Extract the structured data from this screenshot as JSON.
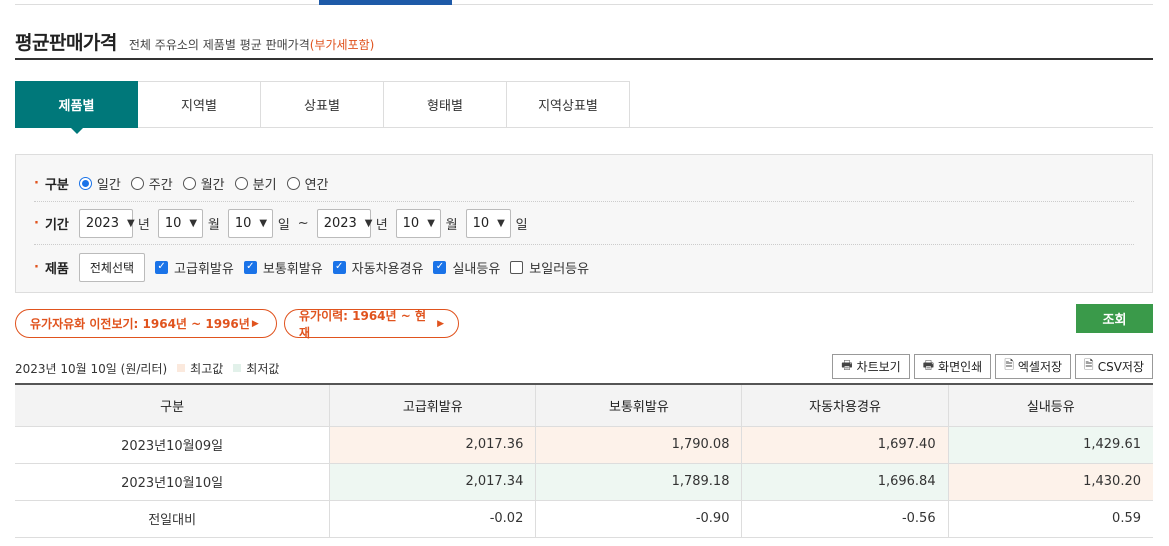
{
  "header": {
    "title": "평균판매가격",
    "subtitle": "전체 주유소의 제품별 평균 판매가격",
    "subtitle_highlight": "(부가세포함)"
  },
  "tabs": [
    {
      "label": "제품별",
      "active": true
    },
    {
      "label": "지역별",
      "active": false
    },
    {
      "label": "상표별",
      "active": false
    },
    {
      "label": "형태별",
      "active": false
    },
    {
      "label": "지역상표별",
      "active": false
    }
  ],
  "filters": {
    "period_type": {
      "label": "구분",
      "options": [
        "일간",
        "주간",
        "월간",
        "분기",
        "연간"
      ],
      "selected": "일간"
    },
    "date_range": {
      "label": "기간",
      "start_year": "2023",
      "start_month": "10",
      "start_day": "10",
      "end_year": "2023",
      "end_month": "10",
      "end_day": "10",
      "unit_year": "년",
      "unit_month": "월",
      "unit_day": "일",
      "separator": "~"
    },
    "products": {
      "label": "제품",
      "select_all_label": "전체선택",
      "items": [
        {
          "label": "고급휘발유",
          "checked": true
        },
        {
          "label": "보통휘발유",
          "checked": true
        },
        {
          "label": "자동차용경유",
          "checked": true
        },
        {
          "label": "실내등유",
          "checked": true
        },
        {
          "label": "보일러등유",
          "checked": false
        }
      ]
    }
  },
  "links": {
    "history_before": "유가자유화 이전보기: 1964년 ~ 1996년",
    "price_history": "유가이력: 1964년 ~ 현재"
  },
  "search_label": "조회",
  "meta": {
    "date_unit": "2023년 10월 10일 (원/리터)",
    "legend_max": "최고값",
    "legend_min": "최저값"
  },
  "tools": {
    "chart": "차트보기",
    "print": "화면인쇄",
    "excel": "엑셀저장",
    "csv": "CSV저장"
  },
  "table": {
    "headers": [
      "구분",
      "고급휘발유",
      "보통휘발유",
      "자동차용경유",
      "실내등유"
    ],
    "rows": [
      {
        "label": "2023년10월09일",
        "values": [
          "2,017.36",
          "1,790.08",
          "1,697.40",
          "1,429.61"
        ]
      },
      {
        "label": "2023년10월10일",
        "values": [
          "2,017.34",
          "1,789.18",
          "1,696.84",
          "1,430.20"
        ]
      },
      {
        "label": "전일대비",
        "values": [
          "-0.02",
          "-0.90",
          "-0.56",
          "0.59"
        ]
      }
    ]
  },
  "colors": {
    "accent": "#00787a",
    "highlight": "#e0531e",
    "search_button": "#3a9a4a",
    "max_cell": "#fdf2ea",
    "min_cell": "#eef7f2"
  }
}
